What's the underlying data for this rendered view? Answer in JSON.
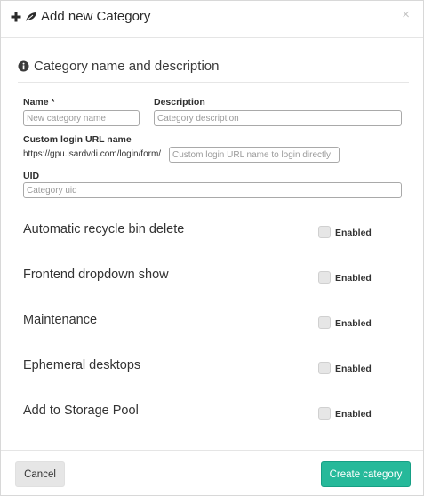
{
  "header": {
    "title": "Add new Category",
    "plus_icon": "plus-icon",
    "leaf_icon": "leaf-icon",
    "close_glyph": "×"
  },
  "section": {
    "title": "Category name and description",
    "icon": "info-circle-icon"
  },
  "form": {
    "name_label": "Name *",
    "name_placeholder": "New category name",
    "name_value": "",
    "description_label": "Description",
    "description_placeholder": "Category description",
    "description_value": "",
    "custom_url_label": "Custom login URL name",
    "custom_url_prefix": "https://gpu.isardvdi.com/login/form/",
    "custom_url_placeholder": "Custom login URL name to login directly",
    "custom_url_value": "",
    "uid_label": "UID",
    "uid_placeholder": "Category uid",
    "uid_value": ""
  },
  "toggles": [
    {
      "label": "Automatic recycle bin delete",
      "state_label": "Enabled",
      "checked": false
    },
    {
      "label": "Frontend dropdown show",
      "state_label": "Enabled",
      "checked": false
    },
    {
      "label": "Maintenance",
      "state_label": "Enabled",
      "checked": false
    },
    {
      "label": "Ephemeral desktops",
      "state_label": "Enabled",
      "checked": false
    },
    {
      "label": "Add to Storage Pool",
      "state_label": "Enabled",
      "checked": false
    }
  ],
  "footer": {
    "cancel_label": "Cancel",
    "create_label": "Create category"
  },
  "colors": {
    "primary": "#26b99a",
    "primary_border": "#169f85",
    "default_button": "#e6e6e6",
    "text": "#333333"
  }
}
